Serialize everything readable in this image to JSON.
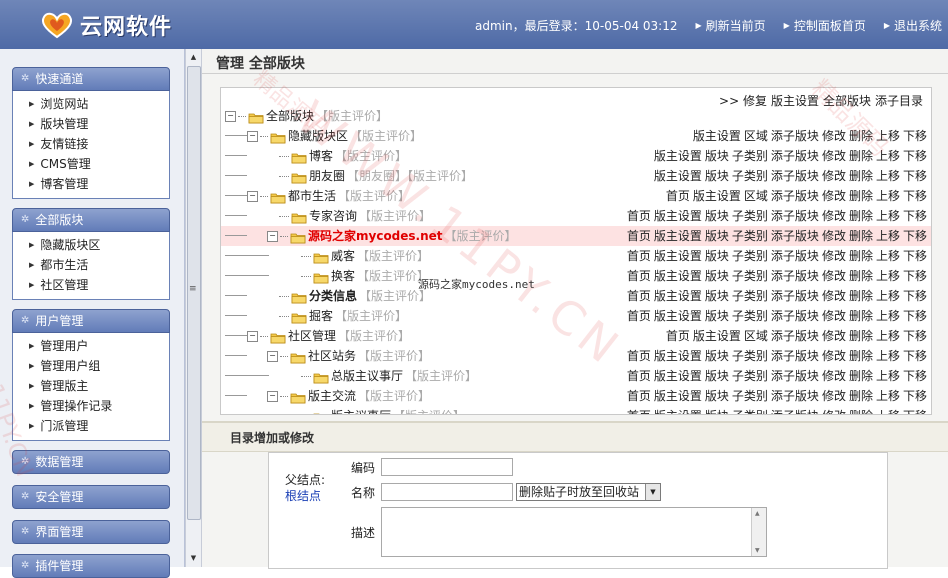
{
  "header": {
    "logo_text": "云网软件",
    "login_info": "admin，最后登录：10-05-04 03:12",
    "links": [
      "刷新当前页",
      "控制面板首页",
      "退出系统"
    ]
  },
  "sidebar": {
    "menus": [
      {
        "title": "快速通道",
        "items": [
          "浏览网站",
          "版块管理",
          "友情链接",
          "CMS管理",
          "博客管理"
        ]
      },
      {
        "title": "全部版块",
        "items": [
          "隐藏版块区",
          "都市生活",
          "社区管理"
        ]
      },
      {
        "title": "用户管理",
        "items": [
          "管理用户",
          "管理用户组",
          "管理版主",
          "管理操作记录",
          "门派管理"
        ]
      },
      {
        "title": "数据管理",
        "items": []
      },
      {
        "title": "安全管理",
        "items": []
      },
      {
        "title": "界面管理",
        "items": []
      },
      {
        "title": "插件管理",
        "items": []
      }
    ]
  },
  "page": {
    "title": "管理 全部版块",
    "top_links": [
      ">> 修复",
      "版主设置",
      "全部版块",
      "添子目录"
    ],
    "tree": [
      {
        "depth": 0,
        "name": "全部版块",
        "tag": "【版主评价】",
        "style": "",
        "toggle": "minus",
        "actions": []
      },
      {
        "depth": 1,
        "name": "隐藏版块区",
        "tag": "【版主评价】",
        "style": "",
        "toggle": "minus",
        "actions": [
          "版主设置",
          "区域",
          "添子版块",
          "修改",
          "删除",
          "上移",
          "下移"
        ]
      },
      {
        "depth": 2,
        "name": "博客",
        "tag": "【版主评价】",
        "style": "",
        "toggle": "",
        "actions": [
          "版主设置",
          "版块",
          "子类别",
          "添子版块",
          "修改",
          "删除",
          "上移",
          "下移"
        ]
      },
      {
        "depth": 2,
        "name": "朋友圈",
        "tag": "【朋友圈】【版主评价】",
        "style": "",
        "toggle": "",
        "actions": [
          "版主设置",
          "版块",
          "子类别",
          "添子版块",
          "修改",
          "删除",
          "上移",
          "下移"
        ]
      },
      {
        "depth": 1,
        "name": "都市生活",
        "tag": "【版主评价】",
        "style": "",
        "toggle": "minus",
        "actions": [
          "首页",
          "版主设置",
          "区域",
          "添子版块",
          "修改",
          "删除",
          "上移",
          "下移"
        ]
      },
      {
        "depth": 2,
        "name": "专家咨询",
        "tag": "【版主评价】",
        "style": "",
        "toggle": "",
        "actions": [
          "首页",
          "版主设置",
          "版块",
          "子类别",
          "添子版块",
          "修改",
          "删除",
          "上移",
          "下移"
        ]
      },
      {
        "depth": 2,
        "name": "源码之家mycodes.net",
        "tag": "【版主评价】",
        "style": "red",
        "toggle": "minus",
        "actions": [
          "首页",
          "版主设置",
          "版块",
          "子类别",
          "添子版块",
          "修改",
          "删除",
          "上移",
          "下移"
        ]
      },
      {
        "depth": 3,
        "name": "威客",
        "tag": "【版主评价】",
        "style": "",
        "toggle": "",
        "actions": [
          "首页",
          "版主设置",
          "版块",
          "子类别",
          "添子版块",
          "修改",
          "删除",
          "上移",
          "下移"
        ]
      },
      {
        "depth": 3,
        "name": "换客",
        "tag": "【版主评价】",
        "style": "",
        "toggle": "",
        "actions": [
          "首页",
          "版主设置",
          "版块",
          "子类别",
          "添子版块",
          "修改",
          "删除",
          "上移",
          "下移"
        ]
      },
      {
        "depth": 2,
        "name": "分类信息",
        "tag": "【版主评价】",
        "style": "bold",
        "toggle": "",
        "actions": [
          "首页",
          "版主设置",
          "版块",
          "子类别",
          "添子版块",
          "修改",
          "删除",
          "上移",
          "下移"
        ]
      },
      {
        "depth": 2,
        "name": "掘客",
        "tag": "【版主评价】",
        "style": "",
        "toggle": "",
        "actions": [
          "首页",
          "版主设置",
          "版块",
          "子类别",
          "添子版块",
          "修改",
          "删除",
          "上移",
          "下移"
        ]
      },
      {
        "depth": 1,
        "name": "社区管理",
        "tag": "【版主评价】",
        "style": "",
        "toggle": "minus",
        "actions": [
          "首页",
          "版主设置",
          "区域",
          "添子版块",
          "修改",
          "删除",
          "上移",
          "下移"
        ]
      },
      {
        "depth": 2,
        "name": "社区站务",
        "tag": "【版主评价】",
        "style": "",
        "toggle": "minus",
        "actions": [
          "首页",
          "版主设置",
          "版块",
          "子类别",
          "添子版块",
          "修改",
          "删除",
          "上移",
          "下移"
        ]
      },
      {
        "depth": 3,
        "name": "总版主议事厅",
        "tag": "【版主评价】",
        "style": "",
        "toggle": "",
        "actions": [
          "首页",
          "版主设置",
          "版块",
          "子类别",
          "添子版块",
          "修改",
          "删除",
          "上移",
          "下移"
        ]
      },
      {
        "depth": 2,
        "name": "版主交流",
        "tag": "【版主评价】",
        "style": "",
        "toggle": "minus",
        "actions": [
          "首页",
          "版主设置",
          "版块",
          "子类别",
          "添子版块",
          "修改",
          "删除",
          "上移",
          "下移"
        ]
      },
      {
        "depth": 3,
        "name": "版主议事厅",
        "tag": "【版主评价】",
        "style": "",
        "toggle": "",
        "actions": [
          "首页",
          "版主设置",
          "版块",
          "子类别",
          "添子版块",
          "修改",
          "删除",
          "上移",
          "下移"
        ]
      }
    ],
    "overlay_text": {
      "cn": "源码之家",
      "en": "mycodes.net"
    },
    "form": {
      "section_title": "目录增加或修改",
      "parent_label": "父结点:",
      "parent_value": "根结点",
      "code_label": "编码",
      "name_label": "名称",
      "select_value": "删除贴子时放至回收站",
      "desc_label": "描述"
    },
    "watermark": {
      "main": "WWW.11PY.CN",
      "a": "精品源码",
      "b": "精品源码",
      "c": "11PY.CN"
    }
  }
}
